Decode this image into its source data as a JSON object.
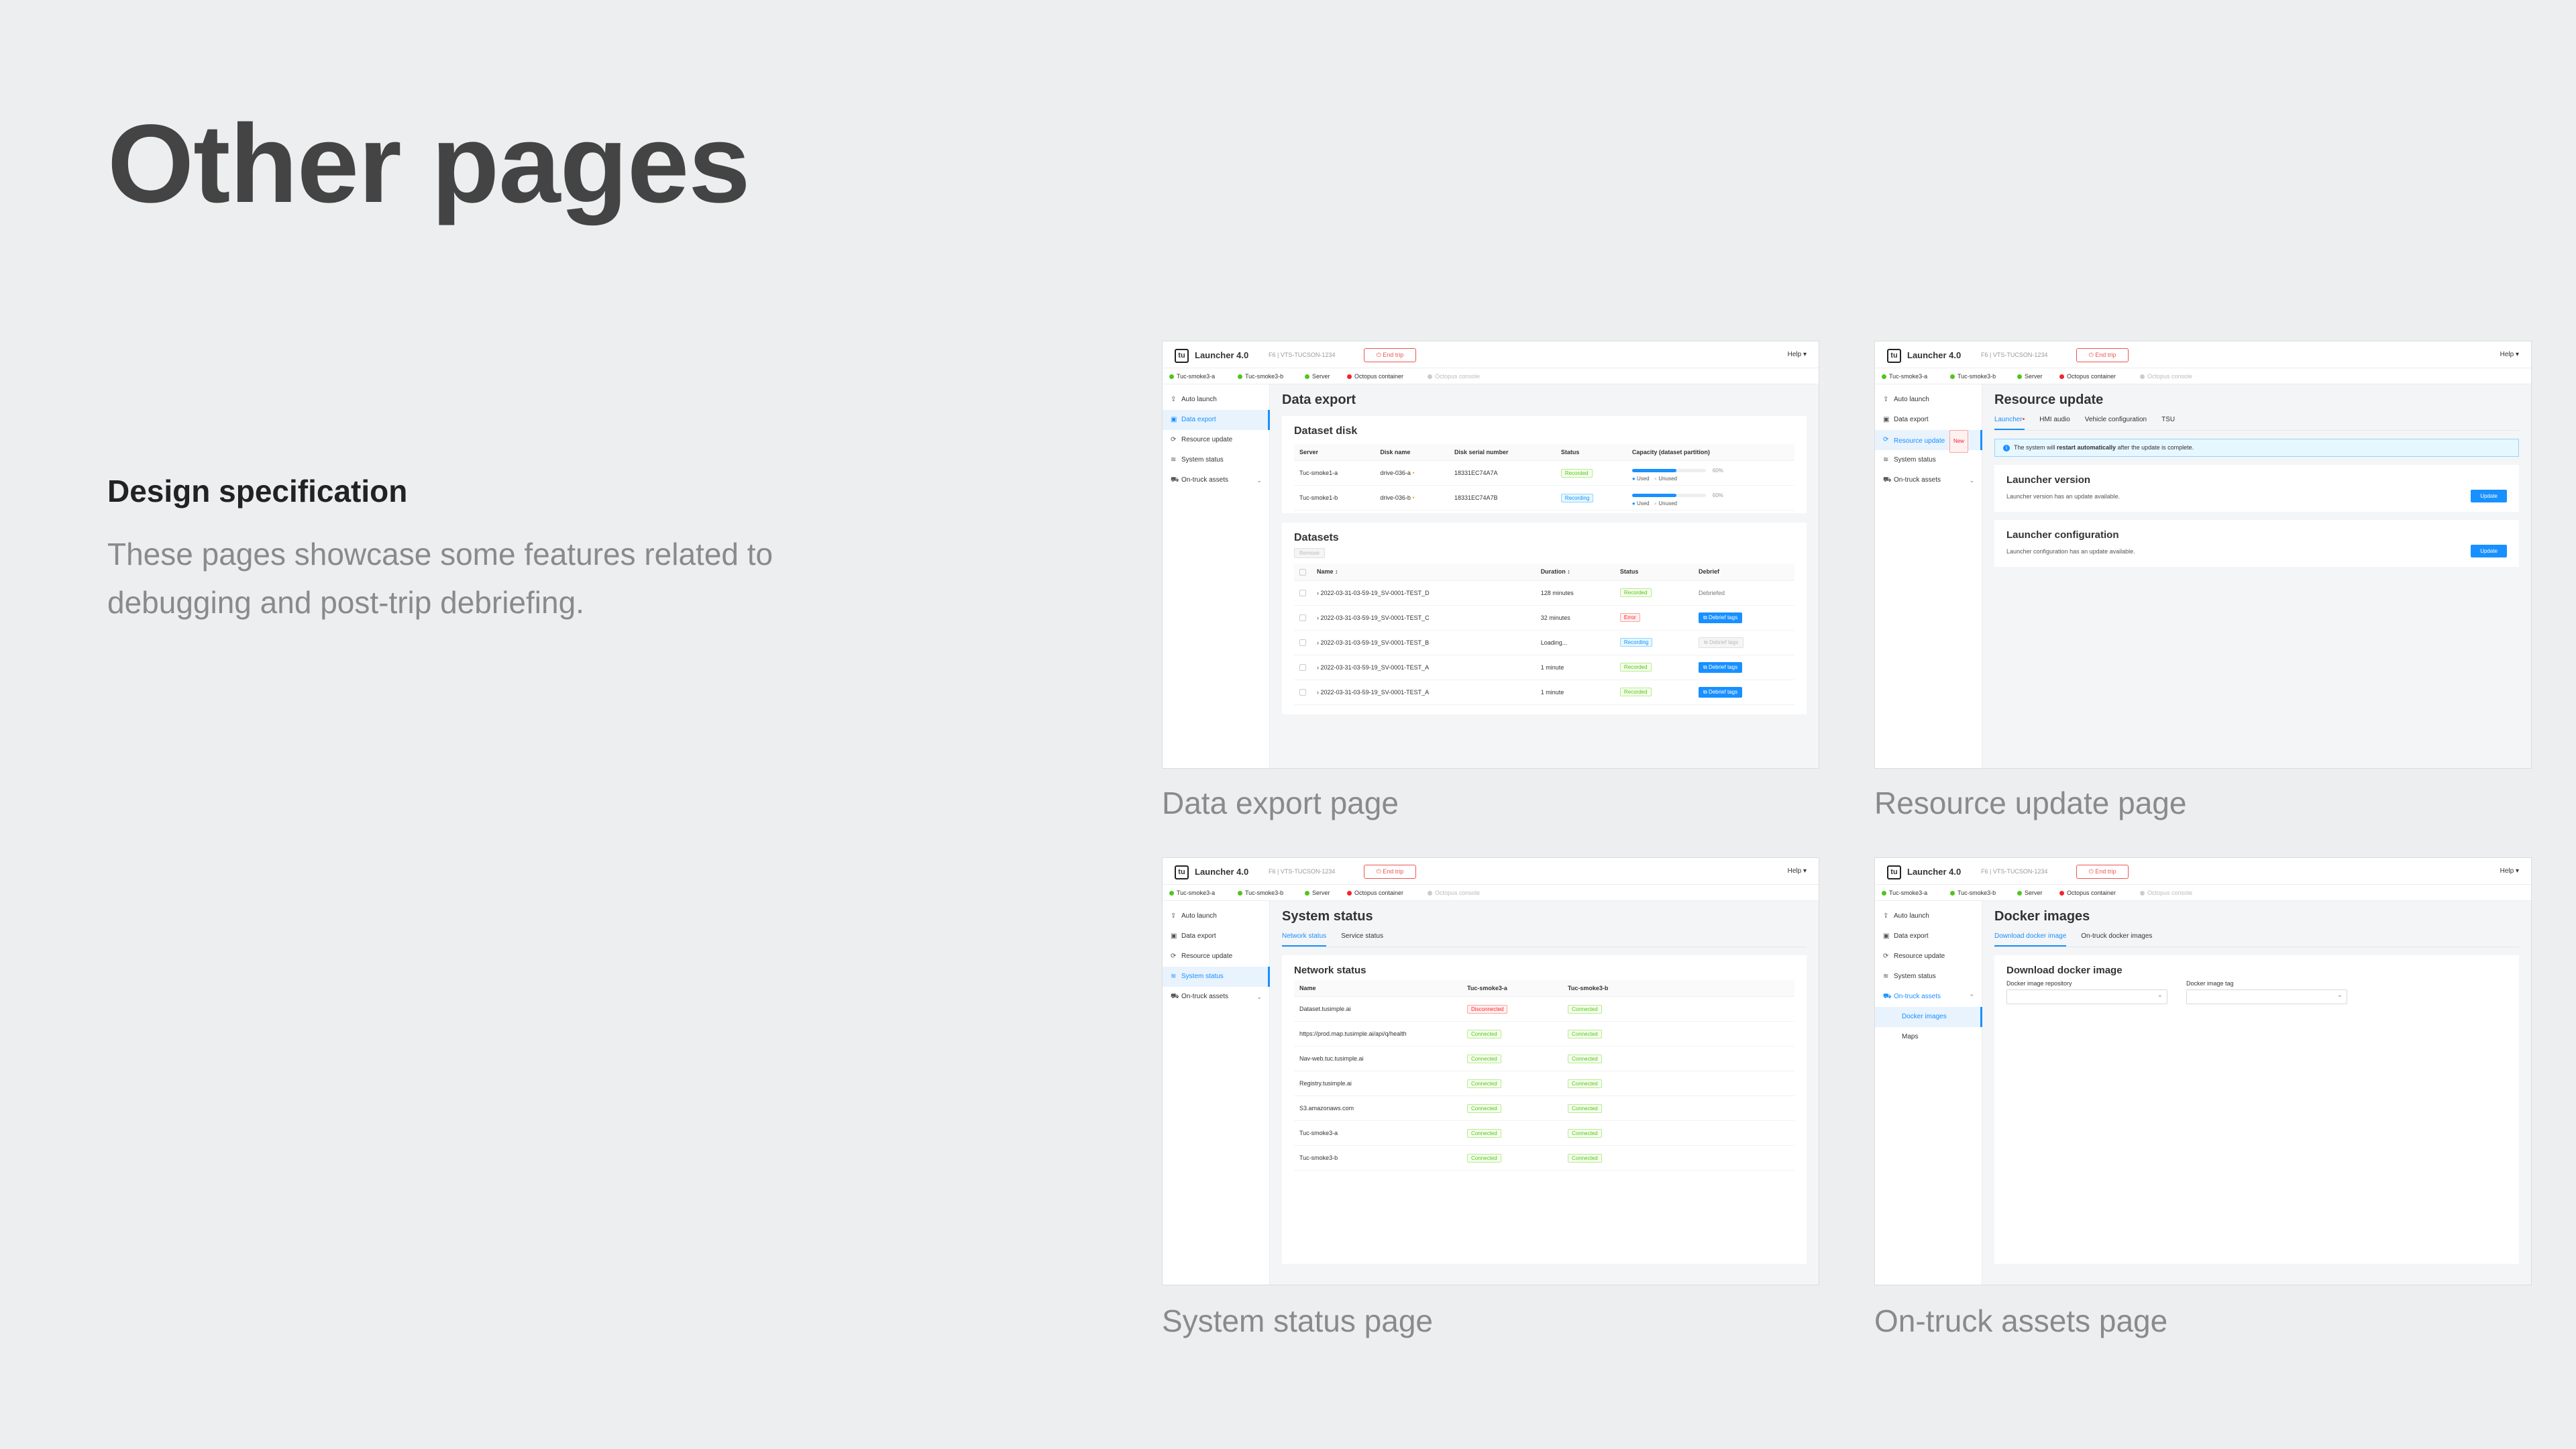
{
  "page": {
    "title": "Other pages",
    "spec_heading": "Design specification",
    "spec_text": "These pages showcase some features related to debugging and post-trip debriefing."
  },
  "common": {
    "logo": "tu",
    "app_name": "Launcher 4.0",
    "app_sub": "F6 | VTS-TUCSON-1234",
    "end_trip": "End trip",
    "help": "Help",
    "status": [
      {
        "label": "Tuc-smoke3-a",
        "color": "#52c41a"
      },
      {
        "label": "Tuc-smoke3-b",
        "color": "#52c41a"
      },
      {
        "label": "Server",
        "color": "#52c41a"
      },
      {
        "label": "Octopus container",
        "color": "#f5222d"
      },
      {
        "label": "Octopus console",
        "color": "#cccccc"
      }
    ],
    "nav": [
      "Auto launch",
      "Data export",
      "Resource update",
      "System status",
      "On-truck assets"
    ],
    "nav_sub": [
      "Docker images",
      "Maps"
    ],
    "resource_badge": "New"
  },
  "data_export": {
    "caption": "Data export page",
    "title": "Data export",
    "disk_title": "Dataset disk",
    "disk_headers": [
      "Server",
      "Disk name",
      "Disk serial number",
      "Status",
      "Capacity (dataset partition)"
    ],
    "disks": [
      {
        "server": "Tuc-smoke1-a",
        "disk": "drive-036-a",
        "serial": "18331EC74A7A",
        "status": "Recorded",
        "pct": "60%",
        "fill": 0.6
      },
      {
        "server": "Tuc-smoke1-b",
        "disk": "drive-036-b",
        "serial": "18331EC74A7B",
        "status": "Recording",
        "pct": "60%",
        "fill": 0.6
      }
    ],
    "legend_used": "Used",
    "legend_unused": "Unused",
    "datasets_title": "Datasets",
    "remove_label": "Remove",
    "ds_headers": [
      "Name",
      "Duration",
      "Status",
      "Debrief"
    ],
    "datasets": [
      {
        "name": "2022-03-31-03-59-19_SV-0001-TEST_D",
        "duration": "128 minutes",
        "status": "Recorded",
        "debrief": "Debriefed"
      },
      {
        "name": "2022-03-31-03-59-19_SV-0001-TEST_C",
        "duration": "32 minutes",
        "status": "Error",
        "debrief": "Debrief tags"
      },
      {
        "name": "2022-03-31-03-59-19_SV-0001-TEST_B",
        "duration": "Loading...",
        "status": "Recording",
        "debrief": "Debrief tags"
      },
      {
        "name": "2022-03-31-03-59-19_SV-0001-TEST_A",
        "duration": "1 minute",
        "status": "Recorded",
        "debrief": "Debrief tags"
      },
      {
        "name": "2022-03-31-03-59-19_SV-0001-TEST_A",
        "duration": "1 minute",
        "status": "Recorded",
        "debrief": "Debrief tags"
      }
    ]
  },
  "resource_update": {
    "caption": "Resource update page",
    "title": "Resource update",
    "tabs": [
      "Launcher",
      "HMI audio",
      "Vehicle configuration",
      "TSU"
    ],
    "alert_pre": "The system will ",
    "alert_bold": "restart automatically",
    "alert_post": " after the update is complete.",
    "cards": [
      {
        "title": "Launcher version",
        "text": "Launcher version has an update available.",
        "button": "Update"
      },
      {
        "title": "Launcher configuration",
        "text": "Launcher configuration has an update available.",
        "button": "Update"
      }
    ]
  },
  "system_status": {
    "caption": "System status page",
    "title": "System status",
    "tabs": [
      "Network status",
      "Service status"
    ],
    "card_title": "Network status",
    "headers": [
      "Name",
      "Tuc-smoke3-a",
      "Tuc-smoke3-b"
    ],
    "rows": [
      {
        "name": "Dataset.tusimple.ai",
        "a": "Disconnected",
        "b": "Connected"
      },
      {
        "name": "https://prod.map.tusimple.ai/api/q/health",
        "a": "Connected",
        "b": "Connected"
      },
      {
        "name": "Nav-web.tuc.tusimple.ai",
        "a": "Connected",
        "b": "Connected"
      },
      {
        "name": "Registry.tusimple.ai",
        "a": "Connected",
        "b": "Connected"
      },
      {
        "name": "S3.amazonaws.com",
        "a": "Connected",
        "b": "Connected"
      },
      {
        "name": "Tuc-smoke3-a",
        "a": "Connected",
        "b": "Connected"
      },
      {
        "name": "Tuc-smoke3-b",
        "a": "Connected",
        "b": "Connected"
      }
    ]
  },
  "on_truck": {
    "caption": "On-truck assets page",
    "title": "Docker images",
    "tabs": [
      "Download docker image",
      "On-truck docker images"
    ],
    "card_title": "Download docker image",
    "repo_label": "Docker image repository",
    "tag_label": "Docker image tag"
  }
}
